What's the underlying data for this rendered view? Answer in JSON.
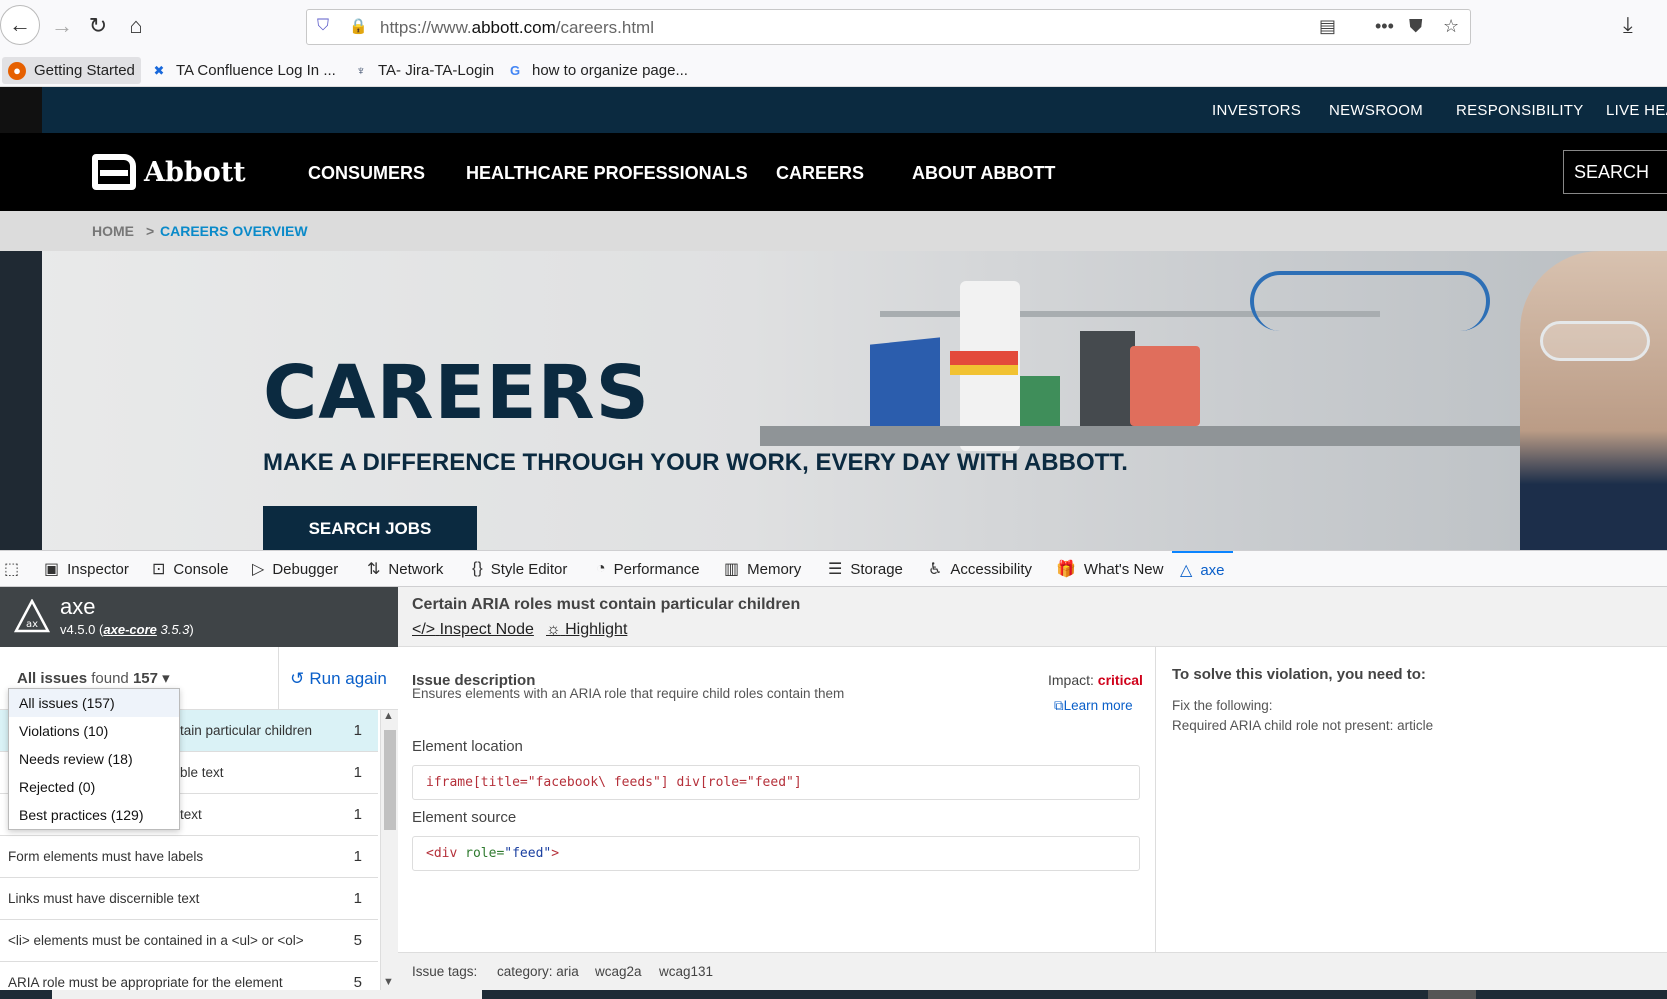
{
  "browser": {
    "url_prefix": "https://www.",
    "url_domain": "abbott.com",
    "url_path": "/careers.html"
  },
  "bookmarks": [
    {
      "label": "Getting Started"
    },
    {
      "label": "TA Confluence Log In ..."
    },
    {
      "label": "TA- Jira-TA-Login"
    },
    {
      "label": "how to organize page..."
    }
  ],
  "site": {
    "util_links": [
      "INVESTORS",
      "NEWSROOM",
      "RESPONSIBILITY",
      "LIVE HEA"
    ],
    "logo": "Abbott",
    "nav": [
      "CONSUMERS",
      "HEALTHCARE PROFESSIONALS",
      "CAREERS",
      "ABOUT ABBOTT"
    ],
    "search_label": "SEARCH",
    "breadcrumb": {
      "home": "HOME",
      "sep": ">",
      "current": "CAREERS OVERVIEW"
    },
    "hero": {
      "title": "CAREERS",
      "subtitle": "MAKE A DIFFERENCE THROUGH YOUR WORK, EVERY DAY WITH ABBOTT.",
      "button": "SEARCH JOBS"
    }
  },
  "devtools": {
    "tabs": [
      "Inspector",
      "Console",
      "Debugger",
      "Network",
      "Style Editor",
      "Performance",
      "Memory",
      "Storage",
      "Accessibility",
      "What's New",
      "axe"
    ],
    "selected_tab": "axe"
  },
  "axe": {
    "name": "axe",
    "version": "v4.5.0",
    "core_link": "axe-core",
    "core_version": "3.5.3",
    "filter_label": "All issues",
    "found_word": "found",
    "count": "157",
    "run_again": "Run again",
    "dropdown": [
      "All issues (157)",
      "Violations (10)",
      "Needs review (18)",
      "Rejected (0)",
      "Best practices (129)"
    ],
    "issues": [
      {
        "text": "tain particular children",
        "count": "1"
      },
      {
        "text": "ble text",
        "count": "1"
      },
      {
        "text": "text",
        "count": "1"
      },
      {
        "text": "Form elements must have labels",
        "count": "1"
      },
      {
        "text": "Links must have discernible text",
        "count": "1"
      },
      {
        "text": "<li> elements must be contained in a <ul> or <ol>",
        "count": "5"
      },
      {
        "text": "ARIA role must be appropriate for the element",
        "count": "5"
      }
    ]
  },
  "detail": {
    "title": "Certain ARIA roles must contain particular children",
    "inspect_node": "Inspect Node",
    "highlight": "Highlight",
    "issue_description_label": "Issue description",
    "description": "Ensures elements with an ARIA role that require child roles contain them",
    "impact_label": "Impact:",
    "impact_value": "critical",
    "learn_more": "Learn more",
    "element_location_label": "Element location",
    "location_a": "iframe[title=\"facebook\\ feeds\"]",
    "location_b": "div[role=\"feed\"]",
    "element_source_label": "Element source",
    "source_open": "<div",
    "source_attr": "role=",
    "source_val": "\"feed\"",
    "source_close": ">",
    "solve_title": "To solve this violation, you need to:",
    "fix_label": "Fix the following:",
    "fix_text": "Required ARIA child role not present: article",
    "tags_label": "Issue tags:",
    "tags": [
      "category: aria",
      "wcag2a",
      "wcag131"
    ]
  }
}
